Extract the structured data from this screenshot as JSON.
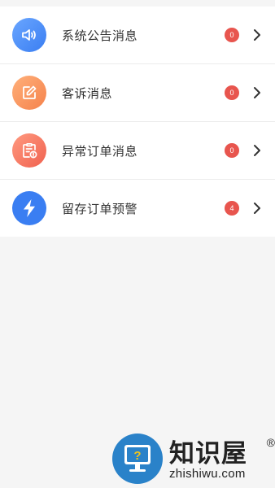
{
  "messages": [
    {
      "label": "系统公告消息",
      "count": "0",
      "icon": "speaker-icon",
      "color": "#4a8ff5",
      "badge_color": "#e8554e"
    },
    {
      "label": "客诉消息",
      "count": "0",
      "icon": "edit-icon",
      "color": "#f7925b",
      "badge_color": "#e8554e"
    },
    {
      "label": "异常订单消息",
      "count": "0",
      "icon": "clipboard-alert-icon",
      "color": "#f5705f",
      "badge_color": "#e8554e"
    },
    {
      "label": "留存订单预警",
      "count": "4",
      "icon": "lightning-icon",
      "color": "#3a7ef2",
      "badge_color": "#e8554e"
    }
  ],
  "watermark": {
    "title": "知识屋",
    "registered": "®",
    "url": "zhishiwu.com",
    "question_mark": "?"
  }
}
